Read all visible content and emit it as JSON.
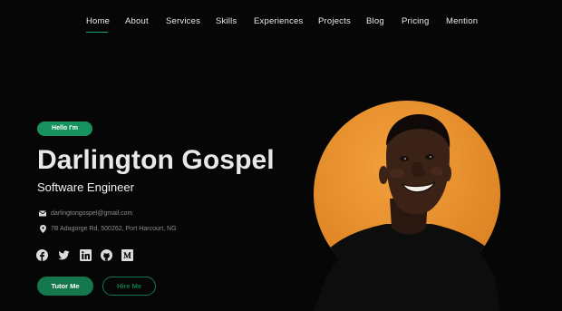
{
  "nav": {
    "items": [
      {
        "label": "Home"
      },
      {
        "label": "About"
      },
      {
        "label": "Services"
      },
      {
        "label": "Skills"
      },
      {
        "label": "Experiences"
      },
      {
        "label": "Projects"
      },
      {
        "label": "Blog"
      },
      {
        "label": "Pricing"
      },
      {
        "label": "Mention"
      }
    ],
    "active": "Home"
  },
  "hero": {
    "pill_label": "Hello I'm",
    "name": "Darlington Gospel",
    "role": "Software Engineer",
    "email": "darlingtongospel@gmail.com",
    "address": "7B Adagorge Rd, 500262, Port Harcourt, NG",
    "socials": [
      "facebook-icon",
      "twitter-icon",
      "linkedin-icon",
      "github-icon",
      "medium-icon"
    ],
    "buttons": {
      "tutor_label": "Tutor Me",
      "hire_label": "Hire Me"
    }
  },
  "colors": {
    "background": "#060606",
    "accent": "#17925f",
    "portrait_bg": "#e08a2a"
  }
}
